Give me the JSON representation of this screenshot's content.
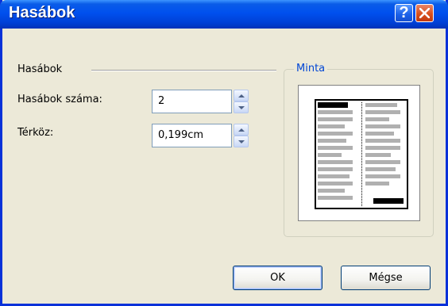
{
  "window": {
    "title": "Hasábok"
  },
  "titlebar": {
    "help_label": "?",
    "close_icon": "close-icon"
  },
  "section": {
    "label": "Hasábok"
  },
  "columns_field": {
    "label": "Hasábok száma:",
    "value": "2"
  },
  "spacing_field": {
    "label": "Térköz:",
    "value": "0,199cm"
  },
  "preview": {
    "legend": "Minta"
  },
  "buttons": {
    "ok": "OK",
    "cancel": "Mégse"
  },
  "colors": {
    "titlebar": "#0050ee",
    "legend_text": "#0046d5",
    "dialog_bg": "#ece9d8",
    "close_button": "#d9501c"
  }
}
